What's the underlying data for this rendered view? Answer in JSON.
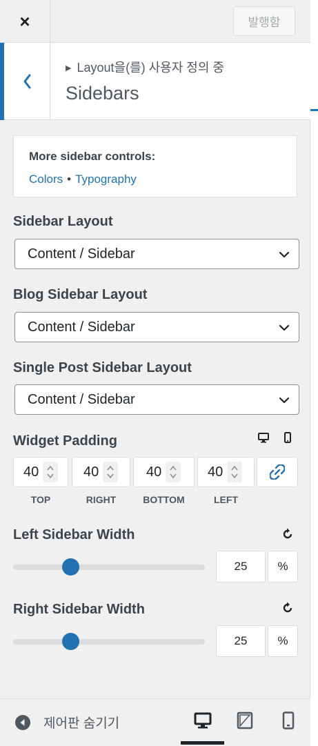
{
  "header": {
    "close_label": "×",
    "publish_label": "발행함"
  },
  "section": {
    "breadcrumb": "Layout을(를) 사용자 정의 중",
    "title": "Sidebars"
  },
  "more_controls": {
    "title": "More sidebar controls:",
    "links": [
      "Colors",
      "Typography"
    ],
    "separator": "•"
  },
  "controls": {
    "sidebar_layout": {
      "label": "Sidebar Layout",
      "value": "Content / Sidebar"
    },
    "blog_sidebar_layout": {
      "label": "Blog Sidebar Layout",
      "value": "Content / Sidebar"
    },
    "single_post_sidebar_layout": {
      "label": "Single Post Sidebar Layout",
      "value": "Content / Sidebar"
    }
  },
  "widget_padding": {
    "label": "Widget Padding",
    "fields": [
      {
        "caption": "TOP",
        "value": "40"
      },
      {
        "caption": "RIGHT",
        "value": "40"
      },
      {
        "caption": "BOTTOM",
        "value": "40"
      },
      {
        "caption": "LEFT",
        "value": "40"
      }
    ]
  },
  "left_sidebar_width": {
    "label": "Left Sidebar Width",
    "value": "25",
    "unit": "%",
    "fraction": 0.25
  },
  "right_sidebar_width": {
    "label": "Right Sidebar Width",
    "value": "25",
    "unit": "%",
    "fraction": 0.25
  },
  "footer": {
    "hide_controls_label": "제어판 숨기기",
    "active_device": "desktop"
  },
  "colors": {
    "accent": "#2271b1",
    "text": "#3c434a",
    "panel_bg": "#f0f0f1"
  }
}
